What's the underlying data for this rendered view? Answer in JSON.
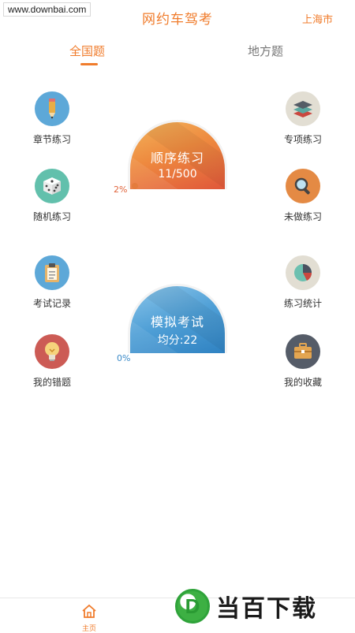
{
  "watermark": "www.downbai.com",
  "header": {
    "title": "网约车驾考",
    "city": "上海市"
  },
  "tabs": [
    {
      "label": "全国题",
      "active": true
    },
    {
      "label": "地方题",
      "active": false
    }
  ],
  "features": {
    "chapter": "章节练习",
    "special": "专项练习",
    "random": "随机练习",
    "undone": "未做练习",
    "exam_record": "考试记录",
    "stats": "练习统计",
    "wrong": "我的错题",
    "favorites": "我的收藏"
  },
  "sequential": {
    "title": "顺序练习",
    "progress": "11/500",
    "percent": "2%"
  },
  "mock_exam": {
    "title": "模拟考试",
    "score": "均分:22",
    "percent": "0%"
  },
  "bottom_nav": {
    "home": "主页"
  },
  "brand": {
    "logo_letter": "D",
    "name": "当百下载"
  },
  "colors": {
    "accent": "#f07c2c",
    "orange_dome": "#ee8a3f",
    "blue_dome": "#4f9fd6"
  }
}
